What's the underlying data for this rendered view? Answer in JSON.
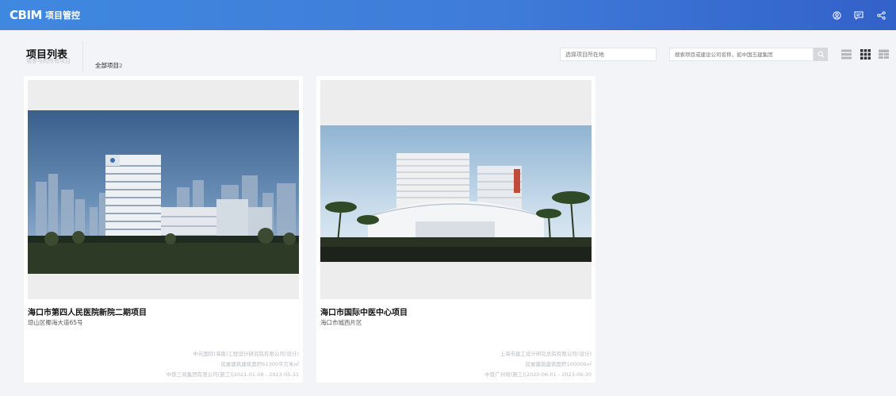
{
  "app": {
    "logo_mark": "CBIM",
    "logo_text": "项目管控"
  },
  "header": {
    "title": "项目列表",
    "subtitle": "我参与的所有项目",
    "filter_label": "全部项目",
    "filter_count": "2",
    "location_placeholder": "选择项目所在地",
    "search_placeholder": "搜索项目或建设公司名称，如中国五建集团"
  },
  "icons": {
    "user": "user-circle-icon",
    "message": "message-icon",
    "share": "share-icon",
    "search": "search-icon",
    "list_view": "list-view-icon",
    "grid_view": "grid-view-icon",
    "table_view": "table-view-icon"
  },
  "colors": {
    "topbar_start": "#3f88e0",
    "topbar_end": "#3361c9",
    "active_view": "#333333",
    "inactive_view": "#b4b6bb"
  },
  "projects": [
    {
      "title": "海口市第四人民医院新院二期项目",
      "address": "琼山区椰海大道65号",
      "design": "中元国际(海南)工程设计研究院有限公司(设计)",
      "area": "房屋建筑建筑面积61300平方米㎡",
      "construction": "中铁三局集团有限公司(施工)|2021-01-08 - 2023-05-31"
    },
    {
      "title": "海口市国际中医中心项目",
      "address": "海口市城西片区",
      "design": "上海市建工设计研究总院有限公司(设计)",
      "area": "房屋建筑建筑面积100000㎡",
      "construction": "中铁广州局(施工)|2020-06-01 - 2023-06-30"
    }
  ]
}
